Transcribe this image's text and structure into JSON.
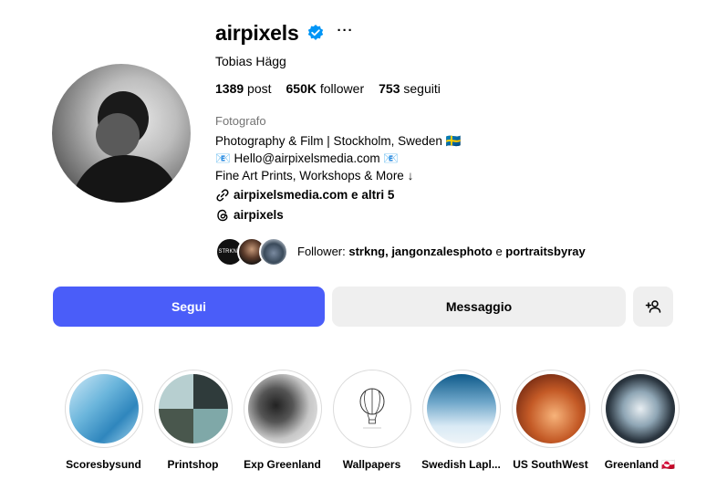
{
  "profile": {
    "username": "airpixels",
    "more_label": "···",
    "full_name": "Tobias Hägg",
    "stats": {
      "posts_count": "1389",
      "posts_label": "post",
      "followers_count": "650K",
      "followers_label": "follower",
      "following_count": "753",
      "following_label": "seguiti"
    },
    "category": "Fotografo",
    "bio": {
      "line1": "Photography & Film | Stockholm, Sweden 🇸🇪",
      "line2": "📧 Hello@airpixelsmedia.com 📧",
      "line3": "Fine Art Prints, Workshops & More ↓"
    },
    "link_text": "airpixelsmedia.com e altri 5",
    "threads_handle": "airpixels",
    "followed_by": {
      "prefix": "Follower: ",
      "names": "strkng, jangonzalesphoto",
      "connector": " e ",
      "last": "portraitsbyray",
      "mini_avatar_text": "STRKNG"
    }
  },
  "actions": {
    "follow_label": "Segui",
    "message_label": "Messaggio"
  },
  "highlights": [
    {
      "label": "Scoresbysund"
    },
    {
      "label": "Printshop"
    },
    {
      "label": "Exp Greenland"
    },
    {
      "label": "Wallpapers"
    },
    {
      "label": "Swedish Lapl..."
    },
    {
      "label": "US SouthWest"
    },
    {
      "label": "Greenland 🇬🇱"
    }
  ],
  "colors": {
    "accent": "#4a5df9",
    "verified": "#0095f6",
    "secondary_button": "#efefef",
    "muted_text": "#737373"
  },
  "icons": [
    "verified-badge-icon",
    "more-options-icon",
    "link-icon",
    "threads-icon",
    "add-user-icon",
    "hot-air-balloon-icon"
  ]
}
